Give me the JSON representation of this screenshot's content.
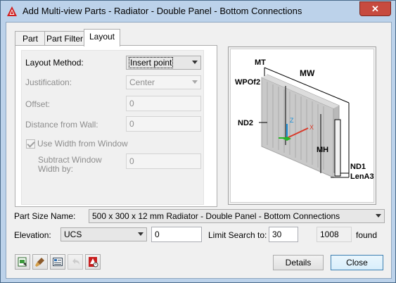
{
  "window": {
    "title": "Add Multi-view Parts - Radiator - Double Panel - Bottom Connections",
    "close_glyph": "✕",
    "icon": "autocad-logo-icon"
  },
  "tabs": [
    {
      "label": "Part",
      "active": false
    },
    {
      "label": "Part Filter",
      "active": false
    },
    {
      "label": "Layout",
      "active": true
    }
  ],
  "layout": {
    "layout_method": {
      "label": "Layout Method:",
      "value": "Insert point"
    },
    "justification": {
      "label": "Justification:",
      "value": "Center"
    },
    "offset": {
      "label": "Offset:",
      "value": "0"
    },
    "distance_from_wall": {
      "label": "Distance from Wall:",
      "value": "0"
    },
    "use_width_from_window": {
      "label": "Use Width from Window",
      "checked": true
    },
    "subtract_window_width": {
      "label_line1": "Subtract Window",
      "label_line2": "Width by:",
      "value": "0"
    }
  },
  "preview": {
    "labels": {
      "mt": "MT",
      "mw": "MW",
      "wpof2": "WPOf2",
      "nd2": "ND2",
      "mh": "MH",
      "nd1": "ND1",
      "lena3": "LenA3",
      "z": "Z",
      "x": "X"
    }
  },
  "part_size": {
    "label": "Part Size Name:",
    "value": "500 x 300 x 12 mm Radiator - Double Panel - Bottom Connections"
  },
  "elevation": {
    "label": "Elevation:",
    "select_value": "UCS",
    "value": "0"
  },
  "limit_search": {
    "label": "Limit Search to:",
    "value": "30",
    "found_count": "1008",
    "found_label": "found"
  },
  "buttons": {
    "details": "Details",
    "close": "Close"
  },
  "toolbar_icons": [
    "replace-part-icon",
    "paint-brush-icon",
    "properties-list-icon",
    "undo-arrow-icon",
    "catalog-icon"
  ],
  "colors": {
    "titlebar": "#bcd2ea",
    "close_button": "#c74b3f",
    "dialog_bg": "#f0f0f0"
  }
}
